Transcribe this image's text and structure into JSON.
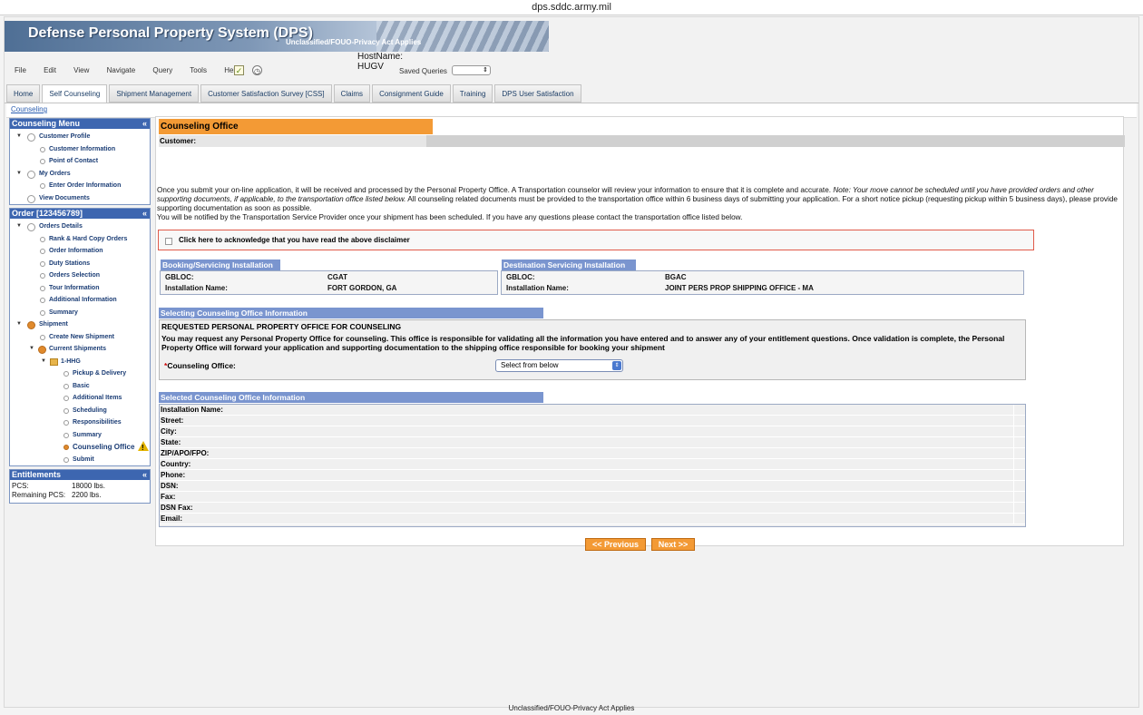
{
  "window": {
    "url_title": "dps.sddc.army.mil"
  },
  "banner": {
    "title": "Defense Personal Property System (DPS)",
    "classification": "Unclassified/FOUO-Privacy Act Applies"
  },
  "host": {
    "label": "HostName:",
    "value": "HUGV"
  },
  "menu": [
    "File",
    "Edit",
    "View",
    "Navigate",
    "Query",
    "Tools",
    "Help"
  ],
  "toolbar": {
    "note_icon": "checklist-icon",
    "clock_icon": "clock-icon",
    "saved_queries_label": "Saved Queries",
    "saved_queries_value": ""
  },
  "tabs": [
    {
      "label": "Home",
      "active": false
    },
    {
      "label": "Self Counseling",
      "active": true
    },
    {
      "label": "Shipment Management",
      "active": false
    },
    {
      "label": "Customer Satisfaction Survey [CSS]",
      "active": false
    },
    {
      "label": "Claims",
      "active": false
    },
    {
      "label": "Consignment Guide",
      "active": false
    },
    {
      "label": "Training",
      "active": false
    },
    {
      "label": "DPS User Satisfaction",
      "active": false
    }
  ],
  "breadcrumb": "Counseling",
  "sidebar": {
    "counseling_menu": {
      "title": "Counseling Menu",
      "items": [
        {
          "label": "Customer Profile"
        },
        {
          "label": "Customer Information"
        },
        {
          "label": "Point of Contact"
        },
        {
          "label": "My Orders"
        },
        {
          "label": "Enter Order Information"
        },
        {
          "label": "View Documents"
        }
      ]
    },
    "order_menu": {
      "title": "Order [123456789]",
      "items": [
        {
          "label": "Orders Details"
        },
        {
          "label": "Rank & Hard Copy Orders"
        },
        {
          "label": "Order Information"
        },
        {
          "label": "Duty Stations"
        },
        {
          "label": "Orders Selection"
        },
        {
          "label": "Tour Information"
        },
        {
          "label": "Additional Information"
        },
        {
          "label": "Summary"
        },
        {
          "label": "Shipment"
        },
        {
          "label": "Create New Shipment"
        },
        {
          "label": "Current Shipments"
        },
        {
          "label": "1-HHG"
        },
        {
          "label": "Pickup & Delivery"
        },
        {
          "label": "Basic"
        },
        {
          "label": "Additional Items"
        },
        {
          "label": "Scheduling"
        },
        {
          "label": "Responsibilities"
        },
        {
          "label": "Summary"
        },
        {
          "label": "Counseling Office"
        },
        {
          "label": "Submit"
        }
      ]
    },
    "entitlements": {
      "title": "Entitlements",
      "rows": [
        {
          "label": "PCS:",
          "value": "18000 lbs."
        },
        {
          "label": "Remaining PCS:",
          "value": "2200 lbs."
        }
      ]
    }
  },
  "main": {
    "title": "Counseling Office",
    "customer_label": "Customer:",
    "intro": {
      "p1_start": "Once you submit your on-line application, it will be received and processed by the Personal Property Office. A Transportation counselor will review your information to ensure that it is complete and accurate.",
      "p1_italic": "Note: Your move cannot be scheduled until you have provided orders and other supporting documents, if applicable, to the transportation office listed below.",
      "p1_end": "All counseling related documents must be provided to the transportation office within 6 business days of submitting your application. For a short notice pickup (requesting pickup within 5 business days), please provide supporting documentation as soon as possible.",
      "p2": "You will be notified by the Transportation Service Provider once your shipment has been scheduled. If you have any questions please contact the transportation office listed below."
    },
    "acknowledge_label": "Click here to acknowledge that you have read the above disclaimer",
    "booking": {
      "title": "Booking/Servicing Installation",
      "gbloc_label": "GBLOC:",
      "gbloc": "CGAT",
      "name_label": "Installation Name:",
      "name": "FORT GORDON, GA"
    },
    "destination": {
      "title": "Destination Servicing Installation",
      "gbloc_label": "GBLOC:",
      "gbloc": "BGAC",
      "name_label": "Installation Name:",
      "name": "JOINT PERS PROP SHIPPING OFFICE - MA"
    },
    "selecting": {
      "title": "Selecting Counseling Office Information",
      "req_title": "REQUESTED PERSONAL PROPERTY OFFICE FOR COUNSELING",
      "req_desc": "You may request any Personal Property Office for counseling. This office is responsible for validating all the information you have entered and to answer any of your entitlement questions. Once validation is complete, the Personal Property Office will forward your application and supporting documentation to the shipping office responsible for booking your shipment",
      "required_mark": "*",
      "field_label": "Counseling Office:",
      "select_value": "Select from below"
    },
    "selected_info": {
      "title": "Selected Counseling Office Information",
      "fields": [
        "Installation Name:",
        "Street:",
        "City:",
        "State:",
        "ZIP/APO/FPO:",
        "Country:",
        "Phone:",
        "DSN:",
        "Fax:",
        "DSN Fax:",
        "Email:"
      ]
    },
    "buttons": {
      "previous": "<< Previous",
      "next": "Next >>"
    }
  },
  "footer": "Unclassified/FOUO-Privacy Act Applies"
}
